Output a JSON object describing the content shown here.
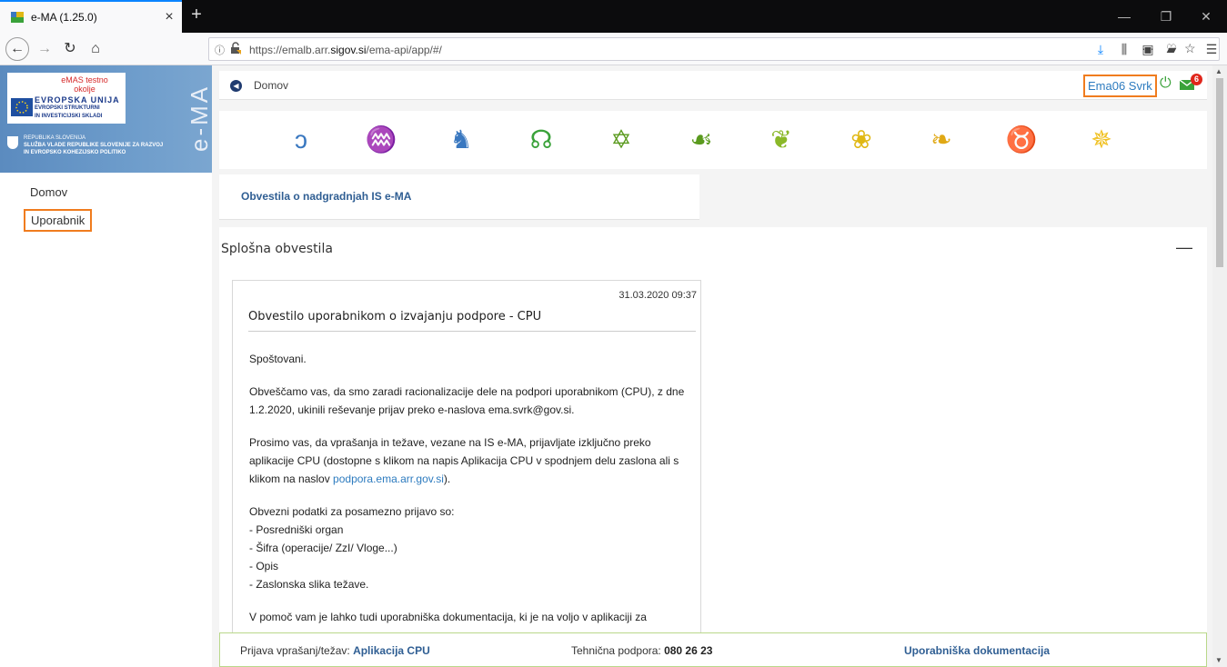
{
  "browser": {
    "tab_title": "e-MA (1.25.0)",
    "tab_close": "×",
    "new_tab": "+",
    "url_prefix": "https://emalb.arr.",
    "url_domain": "sigov.si",
    "url_suffix": "/ema-api/app/#/",
    "more": "···"
  },
  "logo": {
    "test_line1": "eMAS testno",
    "test_line2": "okolje",
    "eu_line1": "EVROPSKA UNIJA",
    "eu_line2": "EVROPSKI STRUKTURNI",
    "eu_line3": "IN INVESTICIJSKI SKLADI",
    "si_line1": "REPUBLIKA SLOVENIJA",
    "si_line2": "SLUŽBA VLADE REPUBLIKE SLOVENIJE ZA RAZVOJ",
    "si_line3": "IN EVROPSKO KOHEZIJSKO POLITIKO",
    "ema": "e-MA"
  },
  "sidebar": {
    "items": [
      {
        "label": "Domov"
      },
      {
        "label": "Uporabnik"
      }
    ]
  },
  "header": {
    "breadcrumb": "Domov",
    "user": "Ema06 Svrk",
    "mail_count": "6"
  },
  "modules": [
    {
      "name": "module-1-icon",
      "glyph": "ↄ",
      "color": "#3a78c0"
    },
    {
      "name": "module-2-icon",
      "glyph": "♒",
      "color": "#3a78c0"
    },
    {
      "name": "module-3-icon",
      "glyph": "♞",
      "color": "#3a78c0"
    },
    {
      "name": "module-4-icon",
      "glyph": "☊",
      "color": "#3aa23a"
    },
    {
      "name": "module-5-icon",
      "glyph": "✡",
      "color": "#5a9a1e"
    },
    {
      "name": "module-6-icon",
      "glyph": "☙",
      "color": "#5a9a1e"
    },
    {
      "name": "module-7-icon",
      "glyph": "❦",
      "color": "#8ab828"
    },
    {
      "name": "module-8-icon",
      "glyph": "❀",
      "color": "#e0b814"
    },
    {
      "name": "module-9-icon",
      "glyph": "❧",
      "color": "#e0a814"
    },
    {
      "name": "module-10-icon",
      "glyph": "♉",
      "color": "#e0a814"
    },
    {
      "name": "module-11-icon",
      "glyph": "✵",
      "color": "#f0c020"
    }
  ],
  "notices_link": "Obvestila o nadgradnjah IS e-MA",
  "general": {
    "title": "Splošna obvestila",
    "collapse": "—"
  },
  "notice": {
    "date": "31.03.2020 09:37",
    "title": "Obvestilo uporabnikom o izvajanju podpore - CPU",
    "p1": "Spoštovani.",
    "p2": "Obveščamo vas, da smo zaradi racionalizacije dele na podpori uporabnikom (CPU), z dne 1.2.2020, ukinili reševanje prijav preko e-naslova ema.svrk@gov.si.",
    "p3_a": "Prosimo vas, da vprašanja in težave, vezane na IS e-MA, prijavljate izključno preko aplikacije CPU (dostopne s klikom na napis Aplikacija CPU v spodnjem delu zaslona ali s klikom na naslov ",
    "p3_link": "podpora.ema.arr.gov.si",
    "p3_b": ").",
    "p4_intro": "Obvezni podatki za posamezno prijavo so:",
    "p4_items": [
      "- Posredniški organ",
      "- Šifra (operacije/ ZzI/ Vloge...)",
      "- Opis",
      "- Zaslonska slika težave."
    ],
    "p5": "V pomoč vam je lahko tudi uporabniška dokumentacija, ki je na voljo v aplikaciji za"
  },
  "footer": {
    "report_label": "Prijava vprašanj/težav: ",
    "report_link": "Aplikacija CPU",
    "support_label": "Tehnična podpora: ",
    "support_phone": "080 26 23",
    "docs_link": "Uporabniška dokumentacija"
  }
}
